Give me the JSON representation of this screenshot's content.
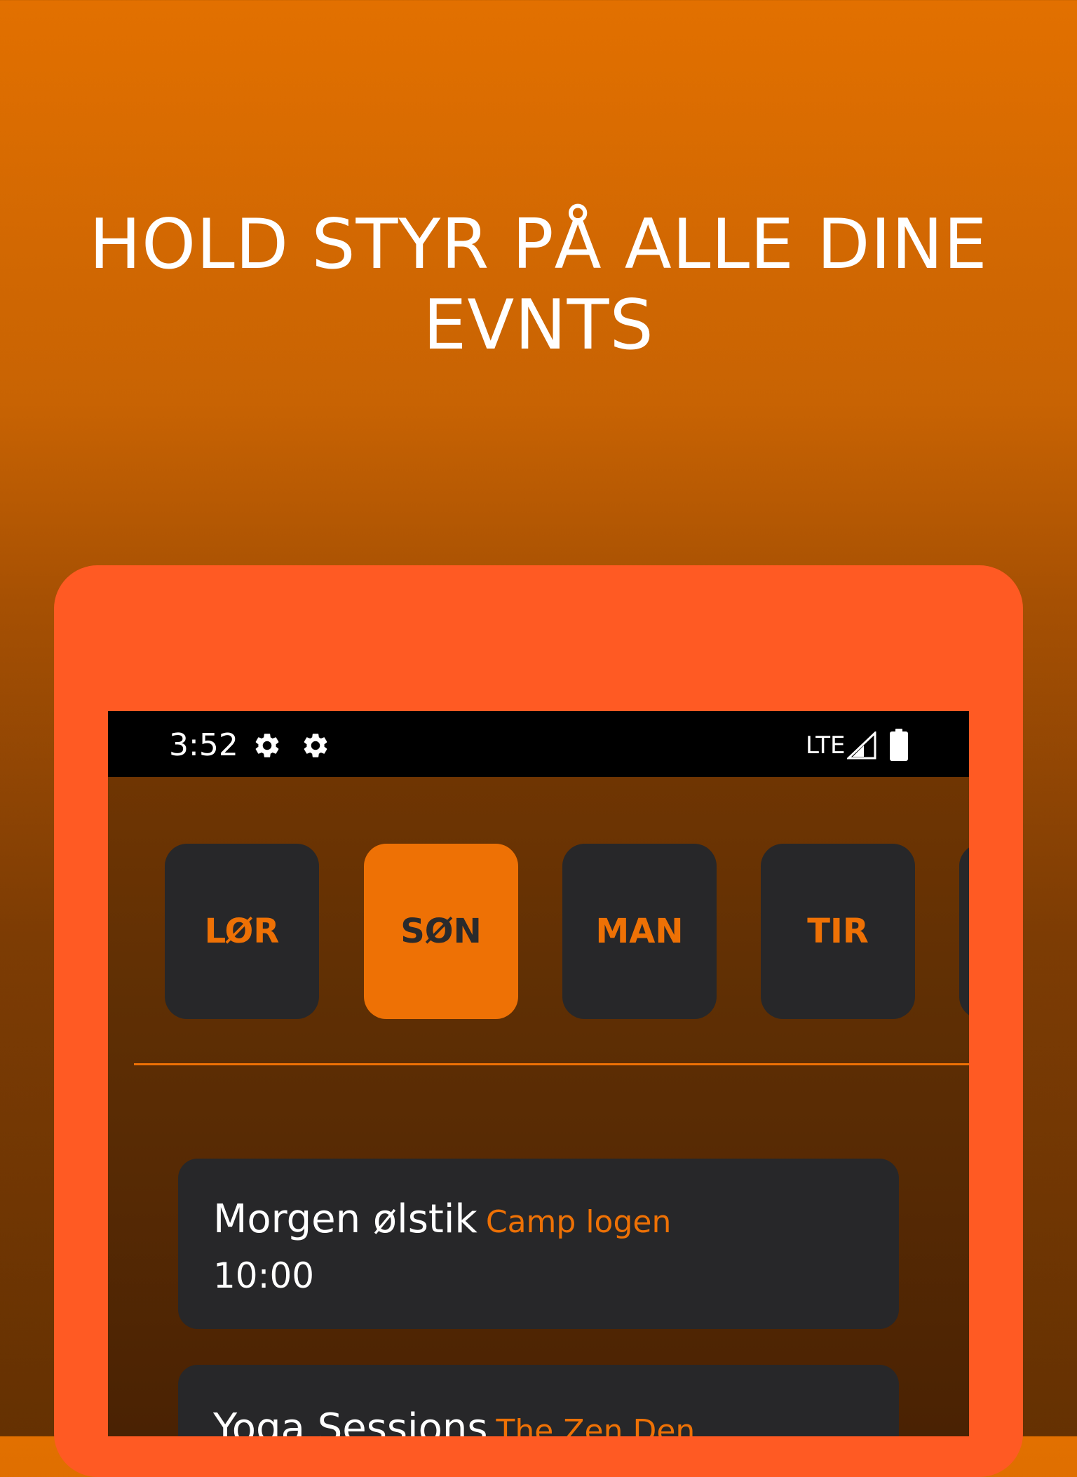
{
  "headline": {
    "line1": "HOLD STYR PÅ ALLE DINE",
    "line2": "EVNTS"
  },
  "status_bar": {
    "time": "3:52",
    "network": "LTE",
    "icons": [
      "gear-icon",
      "gear-icon",
      "signal-icon",
      "battery-icon"
    ]
  },
  "days": [
    {
      "label": "LØR",
      "selected": false
    },
    {
      "label": "SØN",
      "selected": true
    },
    {
      "label": "MAN",
      "selected": false
    },
    {
      "label": "TIR",
      "selected": false
    },
    {
      "label": "",
      "selected": false
    }
  ],
  "events": [
    {
      "title": "Morgen ølstik",
      "location": "Camp logen",
      "time": "10:00"
    },
    {
      "title": "Yoga Sessions",
      "location": "The Zen Den",
      "time": ""
    }
  ],
  "colors": {
    "accent": "#ee7105",
    "frame": "#ff5a23",
    "card": "#272729"
  }
}
